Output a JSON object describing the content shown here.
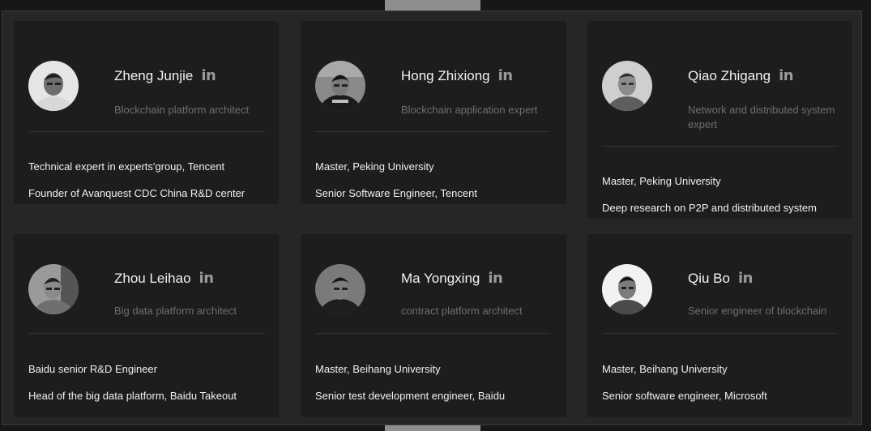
{
  "team": [
    {
      "name": "Zheng Junjie",
      "role": "Blockchain platform architect",
      "details": [
        "Technical expert in experts'group, Tencent",
        "Founder of Avanquest CDC China R&D center"
      ],
      "linkedin_label": "in"
    },
    {
      "name": "Hong Zhixiong",
      "role": "Blockchain application expert",
      "details": [
        "Master, Peking University",
        "Senior Software Engineer, Tencent"
      ],
      "linkedin_label": "in"
    },
    {
      "name": "Qiao Zhigang",
      "role": "Network and distributed system expert",
      "details": [
        "Master, Peking University",
        "Deep research on P2P and distributed system"
      ],
      "linkedin_label": "in"
    },
    {
      "name": "Zhou Leihao",
      "role": "Big data platform architect",
      "details": [
        "Baidu senior R&D Engineer",
        "Head of the big data platform, Baidu Takeout"
      ],
      "linkedin_label": "in"
    },
    {
      "name": "Ma Yongxing",
      "role": "contract platform architect",
      "details": [
        "Master, Beihang University",
        "Senior test development engineer, Baidu"
      ],
      "linkedin_label": "in"
    },
    {
      "name": "Qiu Bo",
      "role": "Senior engineer of blockchain",
      "details": [
        "Master, Beihang University",
        "Senior software engineer, Microsoft"
      ],
      "linkedin_label": "in"
    }
  ],
  "colors": {
    "page_background": "#171717",
    "panel_background": "#262626",
    "card_background": "#1d1d1d",
    "name_text": "#f2f2f2",
    "role_text": "#6e6e6e",
    "detail_text": "#f0f0f0",
    "linkedin_icon": "#9a9a9a"
  }
}
